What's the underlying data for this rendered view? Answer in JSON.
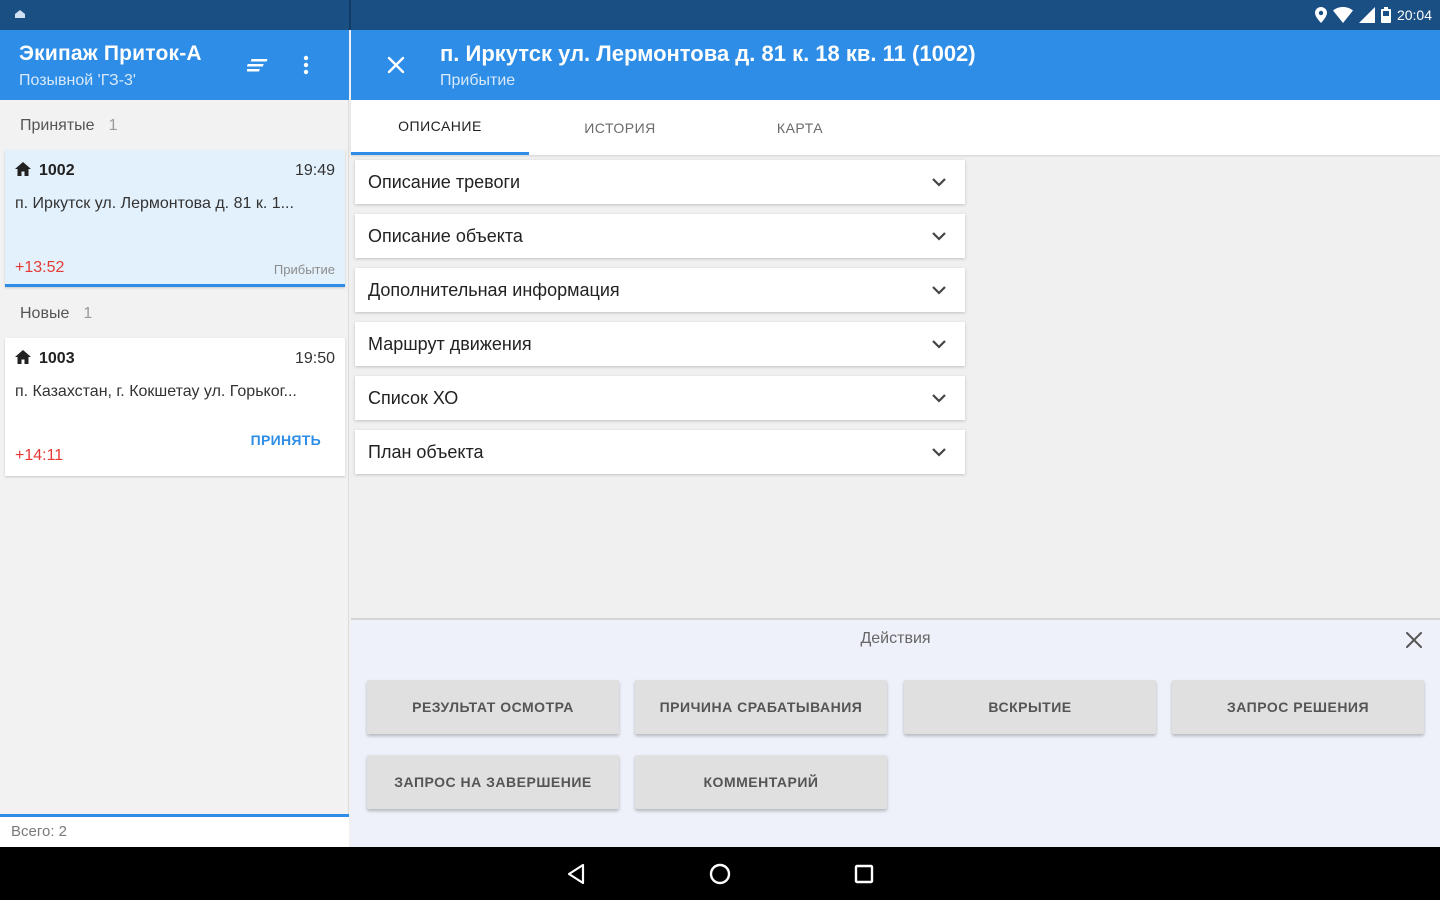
{
  "status_bar": {
    "time": "20:04"
  },
  "crew": {
    "title": "Экипаж Приток-А",
    "callsign": "Позывной 'ГЗ-3'"
  },
  "sections": {
    "accepted": {
      "label": "Принятые",
      "count": "1"
    },
    "new": {
      "label": "Новые",
      "count": "1"
    }
  },
  "cards": [
    {
      "id": "1002",
      "time": "19:49",
      "address": "п. Иркутск ул. Лермонтова д. 81 к. 1...",
      "elapsed": "+13:52",
      "state": "Прибытие"
    },
    {
      "id": "1003",
      "time": "19:50",
      "address": "п. Казахстан, г. Кокшетау ул. Горьког...",
      "elapsed": "+14:11",
      "action": "ПРИНЯТЬ"
    }
  ],
  "footer": {
    "total": "Всего: 2"
  },
  "call": {
    "title": "п. Иркутск ул. Лермонтова д. 81 к. 18 кв. 11 (1002)",
    "state": "Прибытие"
  },
  "tabs": [
    {
      "label": "ОПИСАНИЕ",
      "active": true
    },
    {
      "label": "ИСТОРИЯ",
      "active": false
    },
    {
      "label": "КАРТА",
      "active": false
    }
  ],
  "accordion": [
    "Описание тревоги",
    "Описание объекта",
    "Дополнительная информация",
    "Маршрут движения",
    "Список ХО",
    "План объекта"
  ],
  "actions": {
    "title": "Действия",
    "buttons": [
      "РЕЗУЛЬТАТ ОСМОТРА",
      "ПРИЧИНА СРАБАТЫВАНИЯ",
      "ВСКРЫТИЕ",
      "ЗАПРОС РЕШЕНИЯ",
      "ЗАПРОС НА ЗАВЕРШЕНИЕ",
      "КОММЕНТАРИЙ"
    ]
  },
  "colors": {
    "primary": "#2e8de6",
    "status_bar": "#1a4f83",
    "elapsed": "#e53935"
  },
  "icons": [
    "location-icon",
    "wifi-icon",
    "signal-icon",
    "battery-icon",
    "filter-icon",
    "more-vert-icon",
    "close-icon",
    "home-icon",
    "chevron-down-icon",
    "back-nav-icon",
    "home-nav-icon",
    "recents-nav-icon"
  ]
}
